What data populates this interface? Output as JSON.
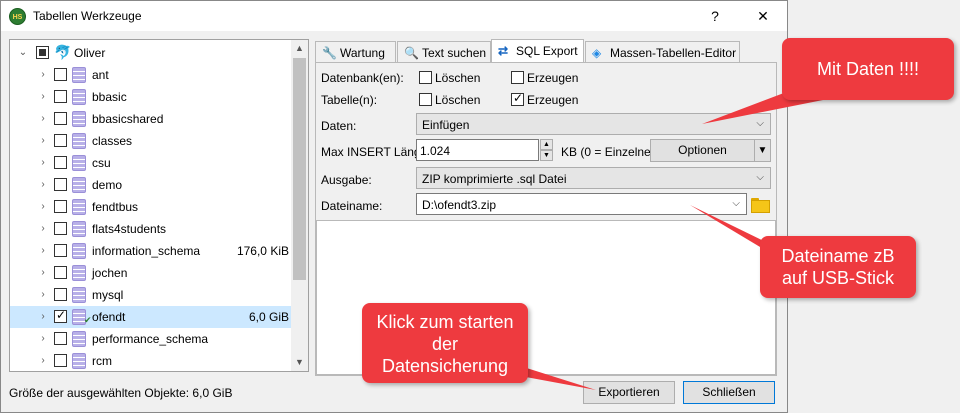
{
  "window": {
    "title": "Tabellen Werkzeuge",
    "app_icon_text": "HS",
    "help_glyph": "?",
    "close_glyph": "✕"
  },
  "tree": {
    "root": {
      "label": "Oliver",
      "checkbox": "partial"
    },
    "items": [
      {
        "label": "ant",
        "size": "",
        "checked": false,
        "selected": false
      },
      {
        "label": "bbasic",
        "size": "",
        "checked": false,
        "selected": false
      },
      {
        "label": "bbasicshared",
        "size": "",
        "checked": false,
        "selected": false
      },
      {
        "label": "classes",
        "size": "",
        "checked": false,
        "selected": false
      },
      {
        "label": "csu",
        "size": "",
        "checked": false,
        "selected": false
      },
      {
        "label": "demo",
        "size": "",
        "checked": false,
        "selected": false
      },
      {
        "label": "fendtbus",
        "size": "",
        "checked": false,
        "selected": false
      },
      {
        "label": "flats4students",
        "size": "",
        "checked": false,
        "selected": false
      },
      {
        "label": "information_schema",
        "size": "176,0 KiB",
        "checked": false,
        "selected": false
      },
      {
        "label": "jochen",
        "size": "",
        "checked": false,
        "selected": false
      },
      {
        "label": "mysql",
        "size": "",
        "checked": false,
        "selected": false
      },
      {
        "label": "ofendt",
        "size": "6,0 GiB",
        "checked": true,
        "selected": true
      },
      {
        "label": "performance_schema",
        "size": "",
        "checked": false,
        "selected": false
      },
      {
        "label": "rcm",
        "size": "",
        "checked": false,
        "selected": false
      }
    ]
  },
  "status": {
    "selected_size_text": "Größe der ausgewählten Objekte: 6,0 GiB"
  },
  "tabs": [
    {
      "label": "Wartung",
      "icon": "wrench-icon",
      "active": false
    },
    {
      "label": "Text suchen",
      "icon": "magnifier-icon",
      "active": false
    },
    {
      "label": "SQL Export",
      "icon": "export-arrows-icon",
      "active": true
    },
    {
      "label": "Massen-Tabellen-Editor",
      "icon": "layers-icon",
      "active": false
    }
  ],
  "export": {
    "databases_label": "Datenbank(en):",
    "tables_label": "Tabelle(n):",
    "delete_label": "Löschen",
    "create_label": "Erzeugen",
    "db_delete_checked": false,
    "db_create_checked": false,
    "tbl_delete_checked": false,
    "tbl_create_checked": true,
    "data_label": "Daten:",
    "data_value": "Einfügen",
    "max_insert_label": "Max INSERT Länge",
    "max_insert_value": "1.024",
    "kb_hint": "KB (0 = Einzelne",
    "options_button": "Optionen",
    "output_label": "Ausgabe:",
    "output_value": "ZIP komprimierte .sql Datei",
    "filename_label": "Dateiname:",
    "filename_value": "D:\\ofendt3.zip"
  },
  "buttons": {
    "export": "Exportieren",
    "close": "Schließen"
  },
  "callouts": {
    "data": "Mit Daten !!!!",
    "filename_line1": "Dateiname zB",
    "filename_line2": "auf USB-Stick",
    "start_line1": "Klick zum starten",
    "start_line2": "der",
    "start_line3": "Datensicherung"
  },
  "colors": {
    "callout": "#ee3a3f",
    "selection": "#cce8ff"
  }
}
